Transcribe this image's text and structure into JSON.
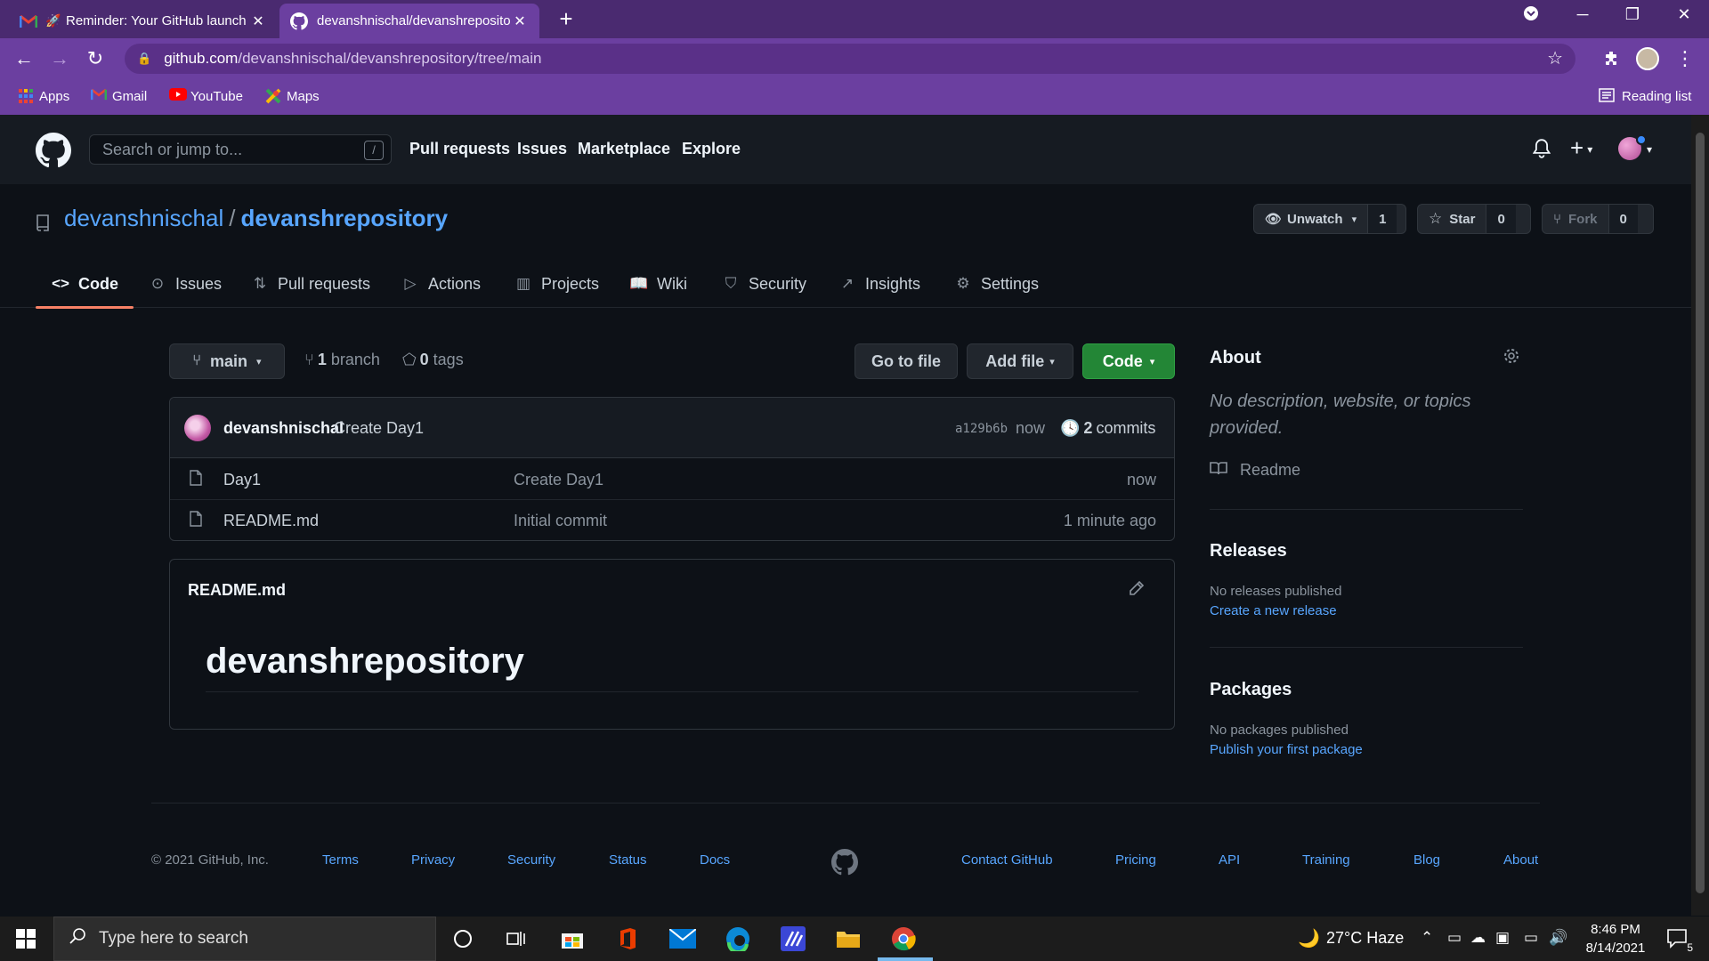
{
  "browser": {
    "tabs": [
      {
        "title": "Reminder: Your GitHub launch",
        "icon": "gmail-icon",
        "active": false
      },
      {
        "title": "devanshnischal/devanshrepository",
        "icon": "github-icon",
        "active": true
      }
    ],
    "url_host": "github.com",
    "url_path": "/devanshnischal/devanshrepository/tree/main",
    "bookmarks": [
      "Apps",
      "Gmail",
      "YouTube",
      "Maps"
    ],
    "reading_list": "Reading list",
    "accent_color": "#6b3fa0"
  },
  "github_header": {
    "search_placeholder": "Search or jump to...",
    "search_shortcut": "/",
    "nav": [
      "Pull requests",
      "Issues",
      "Marketplace",
      "Explore"
    ]
  },
  "repo": {
    "owner": "devanshnischal",
    "name": "devanshrepository",
    "separator": "/",
    "watch": {
      "label": "Unwatch",
      "count": "1"
    },
    "star": {
      "label": "Star",
      "count": "0"
    },
    "fork": {
      "label": "Fork",
      "count": "0"
    },
    "tabs": [
      "Code",
      "Issues",
      "Pull requests",
      "Actions",
      "Projects",
      "Wiki",
      "Security",
      "Insights",
      "Settings"
    ],
    "selected_tab": "Code"
  },
  "toolbar": {
    "branch": "main",
    "branch_count": "1",
    "branch_label": "branch",
    "tag_count": "0",
    "tag_label": "tags",
    "go_to_file": "Go to file",
    "add_file": "Add file",
    "code": "Code"
  },
  "latest_commit": {
    "author": "devanshnischal",
    "message": "Create Day1",
    "sha": "a129b6b",
    "time": "now",
    "commit_count": "2",
    "commit_label": "commits"
  },
  "files": [
    {
      "name": "Day1",
      "message": "Create Day1",
      "age": "now"
    },
    {
      "name": "README.md",
      "message": "Initial commit",
      "age": "1 minute ago"
    }
  ],
  "readme": {
    "filename": "README.md",
    "heading": "devanshrepository"
  },
  "sidebar": {
    "about_title": "About",
    "about_desc": "No description, website, or topics provided.",
    "readme_label": "Readme",
    "releases_title": "Releases",
    "releases_none": "No releases published",
    "releases_link": "Create a new release",
    "packages_title": "Packages",
    "packages_none": "No packages published",
    "packages_link": "Publish your first package"
  },
  "footer": {
    "copyright": "© 2021 GitHub, Inc.",
    "links_left": [
      "Terms",
      "Privacy",
      "Security",
      "Status",
      "Docs"
    ],
    "links_right": [
      "Contact GitHub",
      "Pricing",
      "API",
      "Training",
      "Blog",
      "About"
    ]
  },
  "taskbar": {
    "search_placeholder": "Type here to search",
    "weather": "27°C  Haze",
    "time": "8:46 PM",
    "date": "8/14/2021",
    "notifications": "5"
  }
}
